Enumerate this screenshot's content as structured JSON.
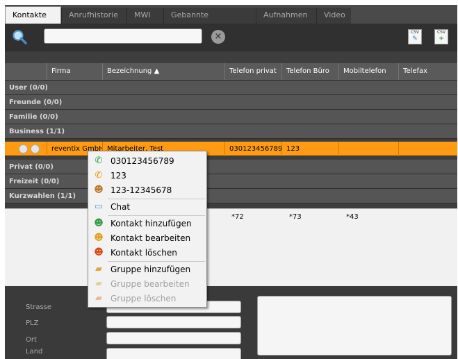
{
  "tabs": [
    "Kontakte",
    "Anrufhistorie",
    "MWI",
    "Gebannte Rufnummern",
    "Aufnahmen",
    "Video"
  ],
  "toolbar": {
    "search_icon": "magnifier-icon",
    "search_value": "",
    "clear_icon": "clear-icon",
    "export_icon_label": "CSV",
    "import_icon_label": "CSV"
  },
  "columns": [
    "Firma",
    "Bezeichnung ▲",
    "Telefon privat",
    "Telefon Büro",
    "Mobiltelefon",
    "Telefax"
  ],
  "groups": {
    "user": "User  (0/0)",
    "freunde": "Freunde  (0/0)",
    "familie": "Familie  (0/0)",
    "business": "Business  (1/1)",
    "privat": "Privat  (0/0)",
    "freizeit": "Freizeit  (0/0)",
    "kurzwahlen": "Kurzwahlen  (1/1)"
  },
  "selected_contact": {
    "firma": "reventix GmbH",
    "bezeichnung": "Mitarbeiter, Test",
    "telefon_privat": "030123456789",
    "telefon_buero": "123",
    "mobiltelefon": "",
    "telefax": ""
  },
  "shortcuts": {
    "privat": "*72",
    "buero": "*73",
    "mobil": "*43"
  },
  "details": {
    "strasse": "Strasse",
    "plz": "PLZ",
    "ort": "Ort",
    "land": "Land"
  },
  "menu": {
    "call_private": "030123456789",
    "call_office": "123",
    "call_mobile": "123-12345678",
    "chat": "Chat",
    "contact_add": "Kontakt hinzufügen",
    "contact_edit": "Kontakt bearbeiten",
    "contact_delete": "Kontakt löschen",
    "group_add": "Gruppe hinzufügen",
    "group_edit": "Gruppe bearbeiten",
    "group_delete": "Gruppe löschen"
  },
  "colors": {
    "selected_row": "#ff9a13",
    "phone_green": "#2f9e44",
    "phone_orange": "#f08c00"
  }
}
